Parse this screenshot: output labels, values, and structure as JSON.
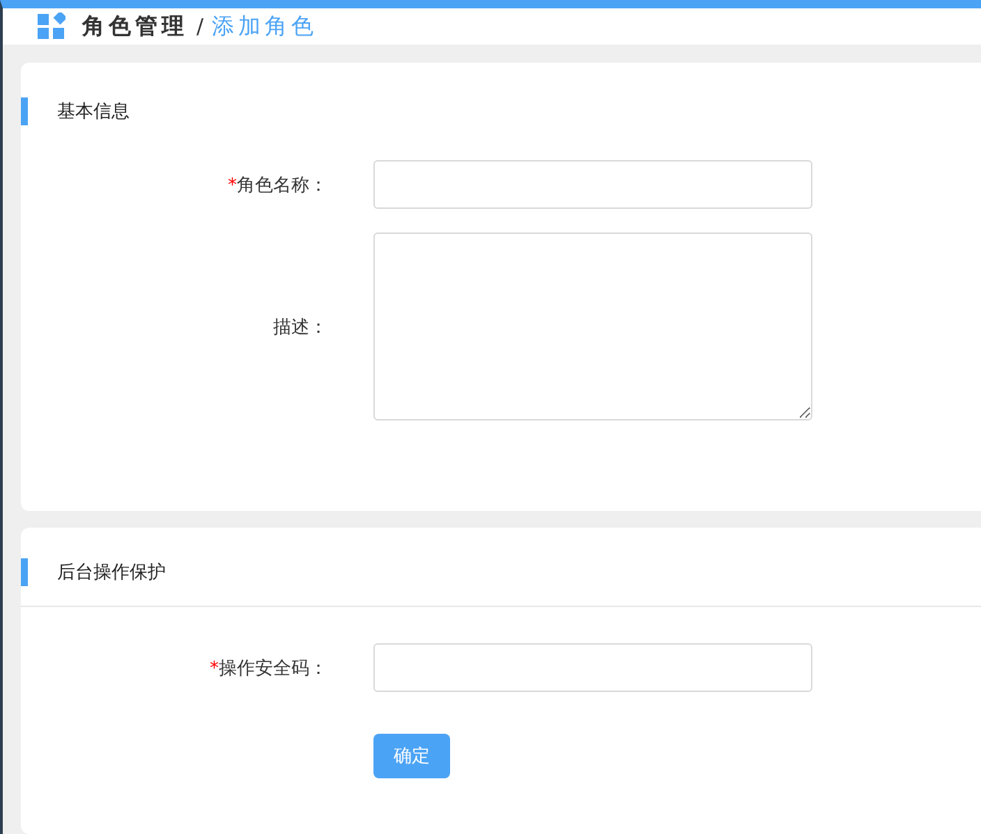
{
  "breadcrumb": {
    "parent": "角色管理",
    "separator": "/",
    "current": "添加角色"
  },
  "sections": [
    {
      "title": "基本信息",
      "divider": false,
      "fields": [
        {
          "kind": "input",
          "required_mark": "*",
          "label": "角色名称："
        },
        {
          "kind": "textarea",
          "label": "描述："
        }
      ]
    },
    {
      "title": "后台操作保护",
      "divider": true,
      "fields": [
        {
          "kind": "input",
          "required_mark": "*",
          "label": "操作安全码："
        }
      ],
      "button": "确定"
    }
  ]
}
